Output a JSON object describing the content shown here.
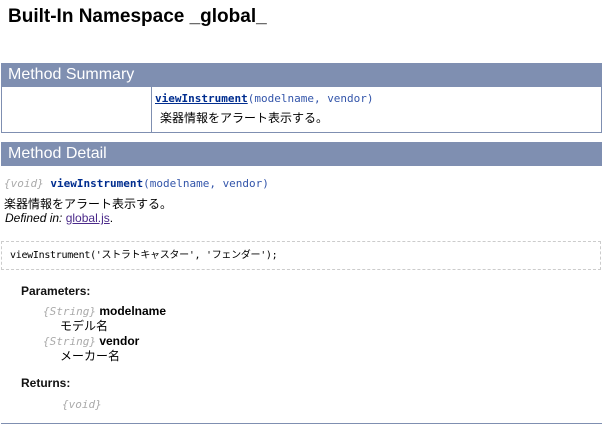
{
  "title": "Built-In Namespace _global_",
  "summary": {
    "header": "Method Summary",
    "method_name": "viewInstrument",
    "method_args": "(modelname, vendor)",
    "description": "楽器情報をアラート表示する。"
  },
  "detail": {
    "header": "Method Detail",
    "return_type": "{void}",
    "method_name": "viewInstrument",
    "method_args": "(modelname, vendor)",
    "description": "楽器情報をアラート表示する。",
    "defined_in_label": "Defined in:",
    "defined_in_file": "global.js",
    "period": ".",
    "example": "viewInstrument('ストラトキャスター', 'フェンダー');",
    "parameters_label": "Parameters:",
    "parameters": [
      {
        "type": "{String}",
        "name": "modelname",
        "desc": "モデル名"
      },
      {
        "type": "{String}",
        "name": "vendor",
        "desc": "メーカー名"
      }
    ],
    "returns_label": "Returns:",
    "returns_type": "{void}"
  }
}
